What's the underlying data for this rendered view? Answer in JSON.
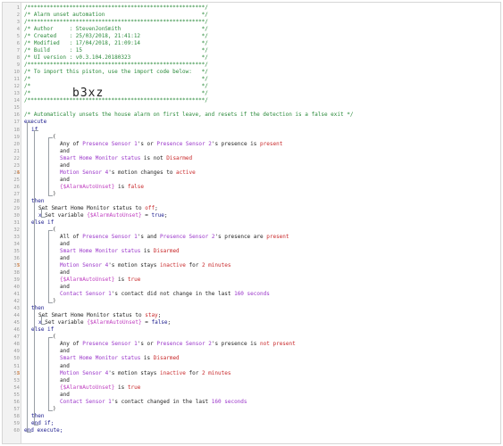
{
  "piston_code": "b3xz",
  "marker": "5",
  "lines": [
    {
      "n": "1",
      "indent": 0,
      "segs": [
        {
          "t": "/*******************************************************/",
          "c": "c"
        }
      ]
    },
    {
      "n": "2",
      "indent": 0,
      "segs": [
        {
          "t": "/* Alarm unset automation                              */",
          "c": "c"
        }
      ]
    },
    {
      "n": "3",
      "indent": 0,
      "segs": [
        {
          "t": "/*******************************************************/",
          "c": "c"
        }
      ]
    },
    {
      "n": "4",
      "indent": 0,
      "segs": [
        {
          "t": "/* Author     : StevenJonSmith                         */",
          "c": "c"
        }
      ]
    },
    {
      "n": "5",
      "indent": 0,
      "segs": [
        {
          "t": "/* Created    : 25/03/2018, 21:41:12                   */",
          "c": "c"
        }
      ]
    },
    {
      "n": "6",
      "indent": 0,
      "segs": [
        {
          "t": "/* Modified   : 17/04/2018, 21:09:14                   */",
          "c": "c"
        }
      ]
    },
    {
      "n": "7",
      "indent": 0,
      "segs": [
        {
          "t": "/* Build      : 15                                     */",
          "c": "c"
        }
      ]
    },
    {
      "n": "8",
      "indent": 0,
      "segs": [
        {
          "t": "/* UI version : v0.3.104.20180323                      */",
          "c": "c"
        }
      ]
    },
    {
      "n": "9",
      "indent": 0,
      "segs": [
        {
          "t": "/*******************************************************/",
          "c": "c"
        }
      ]
    },
    {
      "n": "10",
      "indent": 0,
      "segs": [
        {
          "t": "/* To import this piston, use the import code below:   */",
          "c": "c"
        }
      ]
    },
    {
      "n": "11",
      "indent": 0,
      "segs": [
        {
          "t": "/*                                                     */",
          "c": "c"
        }
      ]
    },
    {
      "n": "12",
      "indent": 0,
      "segs": [
        {
          "t": "/*                                                     */",
          "c": "c"
        }
      ]
    },
    {
      "n": "13",
      "indent": 0,
      "segs": [
        {
          "t": "/*                                                     */",
          "c": "c"
        }
      ]
    },
    {
      "n": "14",
      "indent": 0,
      "segs": [
        {
          "t": "/*******************************************************/",
          "c": "c"
        }
      ]
    },
    {
      "n": "15",
      "indent": 0,
      "segs": []
    },
    {
      "n": "16",
      "indent": 0,
      "segs": [
        {
          "t": "/* Automatically unsets the house alarm on first leave, and resets if the detection is a false exit */",
          "c": "c"
        }
      ]
    },
    {
      "n": "17",
      "indent": 0,
      "segs": [
        {
          "t": "execute",
          "c": "k"
        }
      ]
    },
    {
      "n": "18",
      "indent": 1,
      "segs": [
        {
          "t": "if",
          "c": "k"
        }
      ]
    },
    {
      "n": "19",
      "indent": 3,
      "segs": [
        {
          "t": "(",
          "c": ""
        }
      ]
    },
    {
      "n": "20",
      "indent": 4,
      "segs": [
        {
          "t": "Any of ",
          "c": ""
        },
        {
          "t": "Presence Sensor 1",
          "c": "dv"
        },
        {
          "t": "'s or ",
          "c": ""
        },
        {
          "t": "Presence Sensor 2",
          "c": "dv"
        },
        {
          "t": "'s presence is ",
          "c": ""
        },
        {
          "t": "present",
          "c": "sv"
        }
      ]
    },
    {
      "n": "21",
      "indent": 4,
      "segs": [
        {
          "t": "and",
          "c": ""
        }
      ]
    },
    {
      "n": "22",
      "indent": 4,
      "segs": [
        {
          "t": "Smart Home Monitor status",
          "c": "dv"
        },
        {
          "t": " is not ",
          "c": ""
        },
        {
          "t": "Disarmed",
          "c": "sv"
        }
      ]
    },
    {
      "n": "23",
      "indent": 4,
      "segs": [
        {
          "t": "and",
          "c": ""
        }
      ]
    },
    {
      "n": "24",
      "indent": 4,
      "segs": [
        {
          "t": "Motion Sensor 4",
          "c": "dv"
        },
        {
          "t": "'s motion changes to ",
          "c": ""
        },
        {
          "t": "active",
          "c": "sv"
        }
      ]
    },
    {
      "n": "25",
      "indent": 4,
      "segs": [
        {
          "t": "and",
          "c": ""
        }
      ]
    },
    {
      "n": "26",
      "indent": 4,
      "segs": [
        {
          "t": "{$AlarmAutoUnset}",
          "c": "va"
        },
        {
          "t": " is ",
          "c": ""
        },
        {
          "t": "false",
          "c": "lit"
        }
      ]
    },
    {
      "n": "27",
      "indent": 3,
      "segs": [
        {
          "t": ")",
          "c": ""
        }
      ]
    },
    {
      "n": "28",
      "indent": 1,
      "segs": [
        {
          "t": "then",
          "c": "k"
        }
      ]
    },
    {
      "n": "29",
      "indent": 2,
      "segs": [
        {
          "t": "Set Smart Home Monitor status to ",
          "c": ""
        },
        {
          "t": "off",
          "c": "sv"
        },
        {
          "t": ";",
          "c": ""
        }
      ]
    },
    {
      "n": "30",
      "indent": 2,
      "segs": [
        {
          "t": "x",
          "c": "k"
        },
        {
          "t": " Set variable ",
          "c": ""
        },
        {
          "t": "{$AlarmAutoUnset}",
          "c": "va"
        },
        {
          "t": " = ",
          "c": ""
        },
        {
          "t": "true",
          "c": "k"
        },
        {
          "t": ";",
          "c": ""
        }
      ]
    },
    {
      "n": "31",
      "indent": 1,
      "segs": [
        {
          "t": "else if",
          "c": "k"
        }
      ]
    },
    {
      "n": "32",
      "indent": 3,
      "segs": [
        {
          "t": "(",
          "c": ""
        }
      ]
    },
    {
      "n": "33",
      "indent": 4,
      "segs": [
        {
          "t": "All of ",
          "c": ""
        },
        {
          "t": "Presence Sensor 1",
          "c": "dv"
        },
        {
          "t": "'s and ",
          "c": ""
        },
        {
          "t": "Presence Sensor 2",
          "c": "dv"
        },
        {
          "t": "'s presence are ",
          "c": ""
        },
        {
          "t": "present",
          "c": "sv"
        }
      ]
    },
    {
      "n": "34",
      "indent": 4,
      "segs": [
        {
          "t": "and",
          "c": ""
        }
      ]
    },
    {
      "n": "35",
      "indent": 4,
      "segs": [
        {
          "t": "Smart Home Monitor status",
          "c": "dv"
        },
        {
          "t": " is ",
          "c": ""
        },
        {
          "t": "Disarmed",
          "c": "sv"
        }
      ]
    },
    {
      "n": "36",
      "indent": 4,
      "segs": [
        {
          "t": "and",
          "c": ""
        }
      ]
    },
    {
      "n": "37",
      "indent": 4,
      "segs": [
        {
          "t": "Motion Sensor 4",
          "c": "dv"
        },
        {
          "t": "'s motion stays ",
          "c": ""
        },
        {
          "t": "inactive",
          "c": "sv"
        },
        {
          "t": " for ",
          "c": ""
        },
        {
          "t": "2 minutes",
          "c": "sv"
        }
      ]
    },
    {
      "n": "38",
      "indent": 4,
      "segs": [
        {
          "t": "and",
          "c": ""
        }
      ]
    },
    {
      "n": "39",
      "indent": 4,
      "segs": [
        {
          "t": "{$AlarmAutoUnset}",
          "c": "va"
        },
        {
          "t": " is ",
          "c": ""
        },
        {
          "t": "true",
          "c": "lit"
        }
      ]
    },
    {
      "n": "40",
      "indent": 4,
      "segs": [
        {
          "t": "and",
          "c": ""
        }
      ]
    },
    {
      "n": "41",
      "indent": 4,
      "segs": [
        {
          "t": "Contact Sensor 1",
          "c": "dv"
        },
        {
          "t": "'s contact did not change in the last ",
          "c": ""
        },
        {
          "t": "160 seconds",
          "c": "dv"
        }
      ]
    },
    {
      "n": "42",
      "indent": 3,
      "segs": [
        {
          "t": ")",
          "c": ""
        }
      ]
    },
    {
      "n": "43",
      "indent": 1,
      "segs": [
        {
          "t": "then",
          "c": "k"
        }
      ]
    },
    {
      "n": "44",
      "indent": 2,
      "segs": [
        {
          "t": "Set Smart Home Monitor status to ",
          "c": ""
        },
        {
          "t": "stay",
          "c": "sv"
        },
        {
          "t": ";",
          "c": ""
        }
      ]
    },
    {
      "n": "45",
      "indent": 2,
      "segs": [
        {
          "t": "x",
          "c": "k"
        },
        {
          "t": " Set variable ",
          "c": ""
        },
        {
          "t": "{$AlarmAutoUnset}",
          "c": "va"
        },
        {
          "t": " = ",
          "c": ""
        },
        {
          "t": "false",
          "c": "k"
        },
        {
          "t": ";",
          "c": ""
        }
      ]
    },
    {
      "n": "46",
      "indent": 1,
      "segs": [
        {
          "t": "else if",
          "c": "k"
        }
      ]
    },
    {
      "n": "47",
      "indent": 3,
      "segs": [
        {
          "t": "(",
          "c": ""
        }
      ]
    },
    {
      "n": "48",
      "indent": 4,
      "segs": [
        {
          "t": "Any of ",
          "c": ""
        },
        {
          "t": "Presence Sensor 1",
          "c": "dv"
        },
        {
          "t": "'s or ",
          "c": ""
        },
        {
          "t": "Presence Sensor 2",
          "c": "dv"
        },
        {
          "t": "'s presence is ",
          "c": ""
        },
        {
          "t": "not present",
          "c": "sv"
        }
      ]
    },
    {
      "n": "49",
      "indent": 4,
      "segs": [
        {
          "t": "and",
          "c": ""
        }
      ]
    },
    {
      "n": "50",
      "indent": 4,
      "segs": [
        {
          "t": "Smart Home Monitor status",
          "c": "dv"
        },
        {
          "t": " is ",
          "c": ""
        },
        {
          "t": "Disarmed",
          "c": "sv"
        }
      ]
    },
    {
      "n": "51",
      "indent": 4,
      "segs": [
        {
          "t": "and",
          "c": ""
        }
      ]
    },
    {
      "n": "52",
      "indent": 4,
      "segs": [
        {
          "t": "Motion Sensor 4",
          "c": "dv"
        },
        {
          "t": "'s motion stays ",
          "c": ""
        },
        {
          "t": "inactive",
          "c": "sv"
        },
        {
          "t": " for ",
          "c": ""
        },
        {
          "t": "2 minutes",
          "c": "sv"
        }
      ]
    },
    {
      "n": "53",
      "indent": 4,
      "segs": [
        {
          "t": "and",
          "c": ""
        }
      ]
    },
    {
      "n": "54",
      "indent": 4,
      "segs": [
        {
          "t": "{$AlarmAutoUnset}",
          "c": "va"
        },
        {
          "t": " is ",
          "c": ""
        },
        {
          "t": "true",
          "c": "lit"
        }
      ]
    },
    {
      "n": "55",
      "indent": 4,
      "segs": [
        {
          "t": "and",
          "c": ""
        }
      ]
    },
    {
      "n": "56",
      "indent": 4,
      "segs": [
        {
          "t": "Contact Sensor 1",
          "c": "dv"
        },
        {
          "t": "'s contact changed in the last ",
          "c": ""
        },
        {
          "t": "160 seconds",
          "c": "dv"
        }
      ]
    },
    {
      "n": "57",
      "indent": 3,
      "segs": [
        {
          "t": ")",
          "c": ""
        }
      ]
    },
    {
      "n": "58",
      "indent": 1,
      "segs": [
        {
          "t": "then",
          "c": "k"
        }
      ]
    },
    {
      "n": "59",
      "indent": 1,
      "segs": [
        {
          "t": "end if;",
          "c": "k"
        }
      ]
    },
    {
      "n": "60",
      "indent": 0,
      "segs": [
        {
          "t": "end execute;",
          "c": "k"
        }
      ]
    }
  ]
}
